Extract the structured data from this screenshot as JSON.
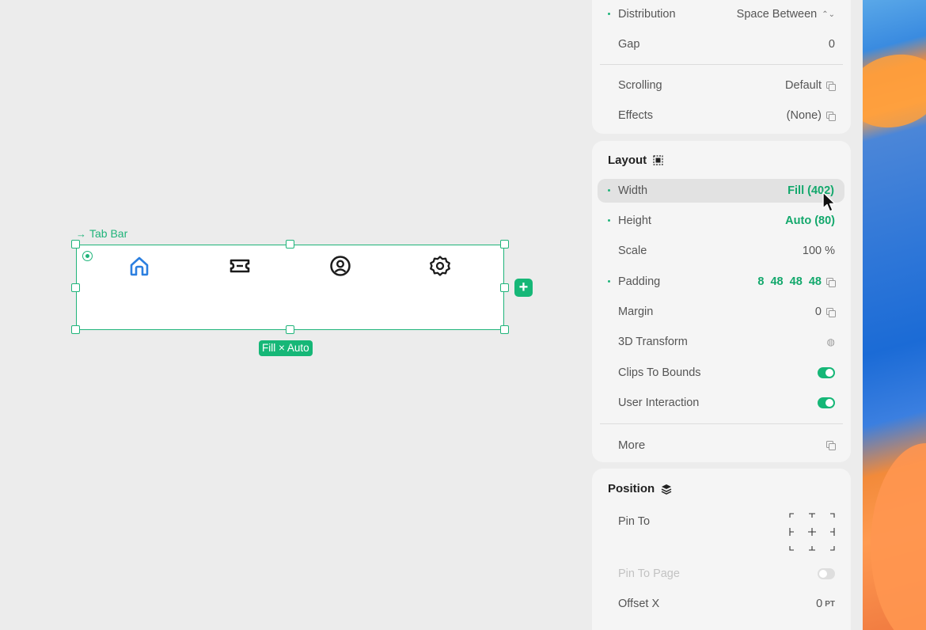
{
  "canvas": {
    "frame_label": "Tab Bar",
    "size_chip": "Fill × Auto",
    "tab_icons": [
      "home-icon",
      "ticket-icon",
      "profile-icon",
      "settings-icon"
    ],
    "active_tab_color": "#2b7fe0",
    "selection_color": "#1fb47a"
  },
  "stack": {
    "distribution": {
      "label": "Distribution",
      "value": "Space Between"
    },
    "gap": {
      "label": "Gap",
      "value": "0"
    },
    "scrolling": {
      "label": "Scrolling",
      "value": "Default"
    },
    "effects": {
      "label": "Effects",
      "value": "(None)"
    }
  },
  "layout": {
    "title": "Layout",
    "width": {
      "label": "Width",
      "value": "Fill (402)"
    },
    "height": {
      "label": "Height",
      "value": "Auto (80)"
    },
    "scale": {
      "label": "Scale",
      "value": "100 %"
    },
    "padding": {
      "label": "Padding",
      "value": "8  48  48  48"
    },
    "margin": {
      "label": "Margin",
      "value": "0"
    },
    "transform3d": {
      "label": "3D Transform"
    },
    "clips": {
      "label": "Clips To Bounds",
      "on": true
    },
    "interaction": {
      "label": "User Interaction",
      "on": true
    },
    "more": {
      "label": "More"
    }
  },
  "position": {
    "title": "Position",
    "pin_to": {
      "label": "Pin To"
    },
    "pin_to_page": {
      "label": "Pin To Page",
      "on": false
    },
    "offset_x": {
      "label": "Offset X",
      "value": "0",
      "unit": "PT"
    }
  }
}
